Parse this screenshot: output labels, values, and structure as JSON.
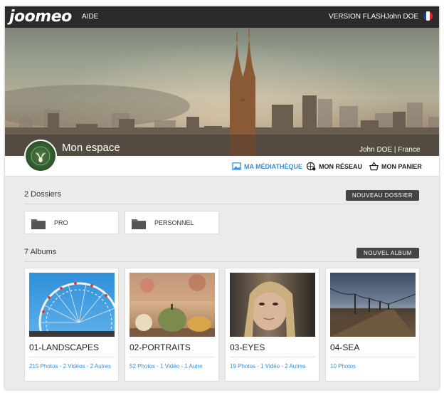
{
  "header": {
    "logo": "joomeo",
    "help_label": "AIDE",
    "flash_label": "VERSION FLASH",
    "user_name": "John DOE",
    "flag_colors": [
      "#1f3d91",
      "#ffffff",
      "#e0262b"
    ]
  },
  "banner": {
    "title": "Mon espace",
    "user_info": "John DOE | France"
  },
  "nav": {
    "items": [
      {
        "label": "MA MÉDIATHÈQUE",
        "icon": "image-icon",
        "active": true
      },
      {
        "label": "MON RÉSEAU",
        "icon": "globe-network-icon",
        "active": false
      },
      {
        "label": "MON PANIER",
        "icon": "basket-icon",
        "active": false
      }
    ]
  },
  "folders": {
    "title": "2 Dossiers",
    "new_button": "NOUVEAU DOSSIER",
    "items": [
      {
        "label": "PRO",
        "icon": "folder-icon"
      },
      {
        "label": "PERSONNEL",
        "icon": "folder-icon"
      }
    ]
  },
  "albums": {
    "title": "7 Albums",
    "new_button": "NOUVEL ALBUM",
    "items": [
      {
        "name": "01-LANDSCAPES",
        "meta": "215 Photos - 2 Vidéos - 2 Autres"
      },
      {
        "name": "02-PORTRAITS",
        "meta": "52 Photos - 1 Vidéo - 1 Autre"
      },
      {
        "name": "03-EYES",
        "meta": "19 Photos - 1 Vidéo - 2 Autres"
      },
      {
        "name": "04-SEA",
        "meta": "10 Photos"
      }
    ]
  },
  "colors": {
    "accent": "#3a8fd1",
    "topbar": "#2b2b2b",
    "button_dark": "#444444"
  }
}
